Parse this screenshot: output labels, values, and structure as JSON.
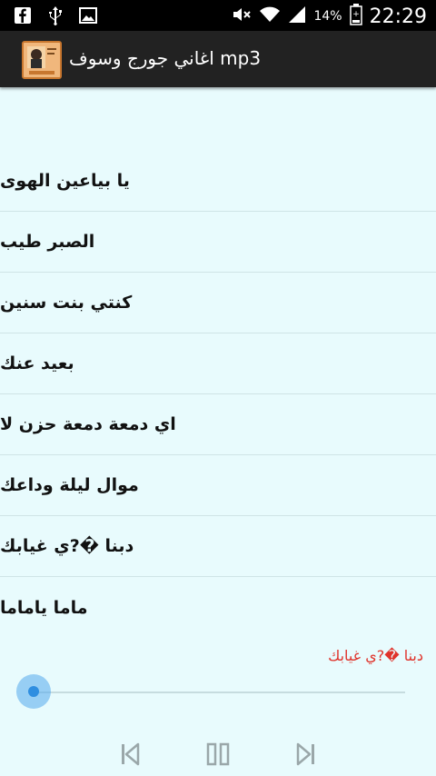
{
  "status_bar": {
    "icons_left": [
      "facebook-icon",
      "usb-icon",
      "image-icon"
    ],
    "icons_right": [
      "mute-icon",
      "wifi-icon",
      "signal-icon"
    ],
    "battery": "14%",
    "time": "22:29"
  },
  "app": {
    "title": "اغاني جورج وسوف mp3",
    "icon": "album-cover-icon"
  },
  "songs": [
    "يا بياعين الهوى",
    "الصبر طيب",
    "كنتي بنت سنين",
    "بعيد عنك",
    "اي دمعة دمعة حزن لا",
    "موال ليلة وداعك",
    "دبنا �?ي غيابك",
    "ماما ياماما"
  ],
  "player": {
    "now_playing": "دبنا �?ي غيابك",
    "progress": 0,
    "controls": [
      "previous-icon",
      "pause-icon",
      "next-icon"
    ]
  },
  "colors": {
    "background": "#e8fbfd",
    "action_bar": "#222222",
    "now_playing": "#e0332b",
    "seek_thumb": "#2f8ee0"
  }
}
